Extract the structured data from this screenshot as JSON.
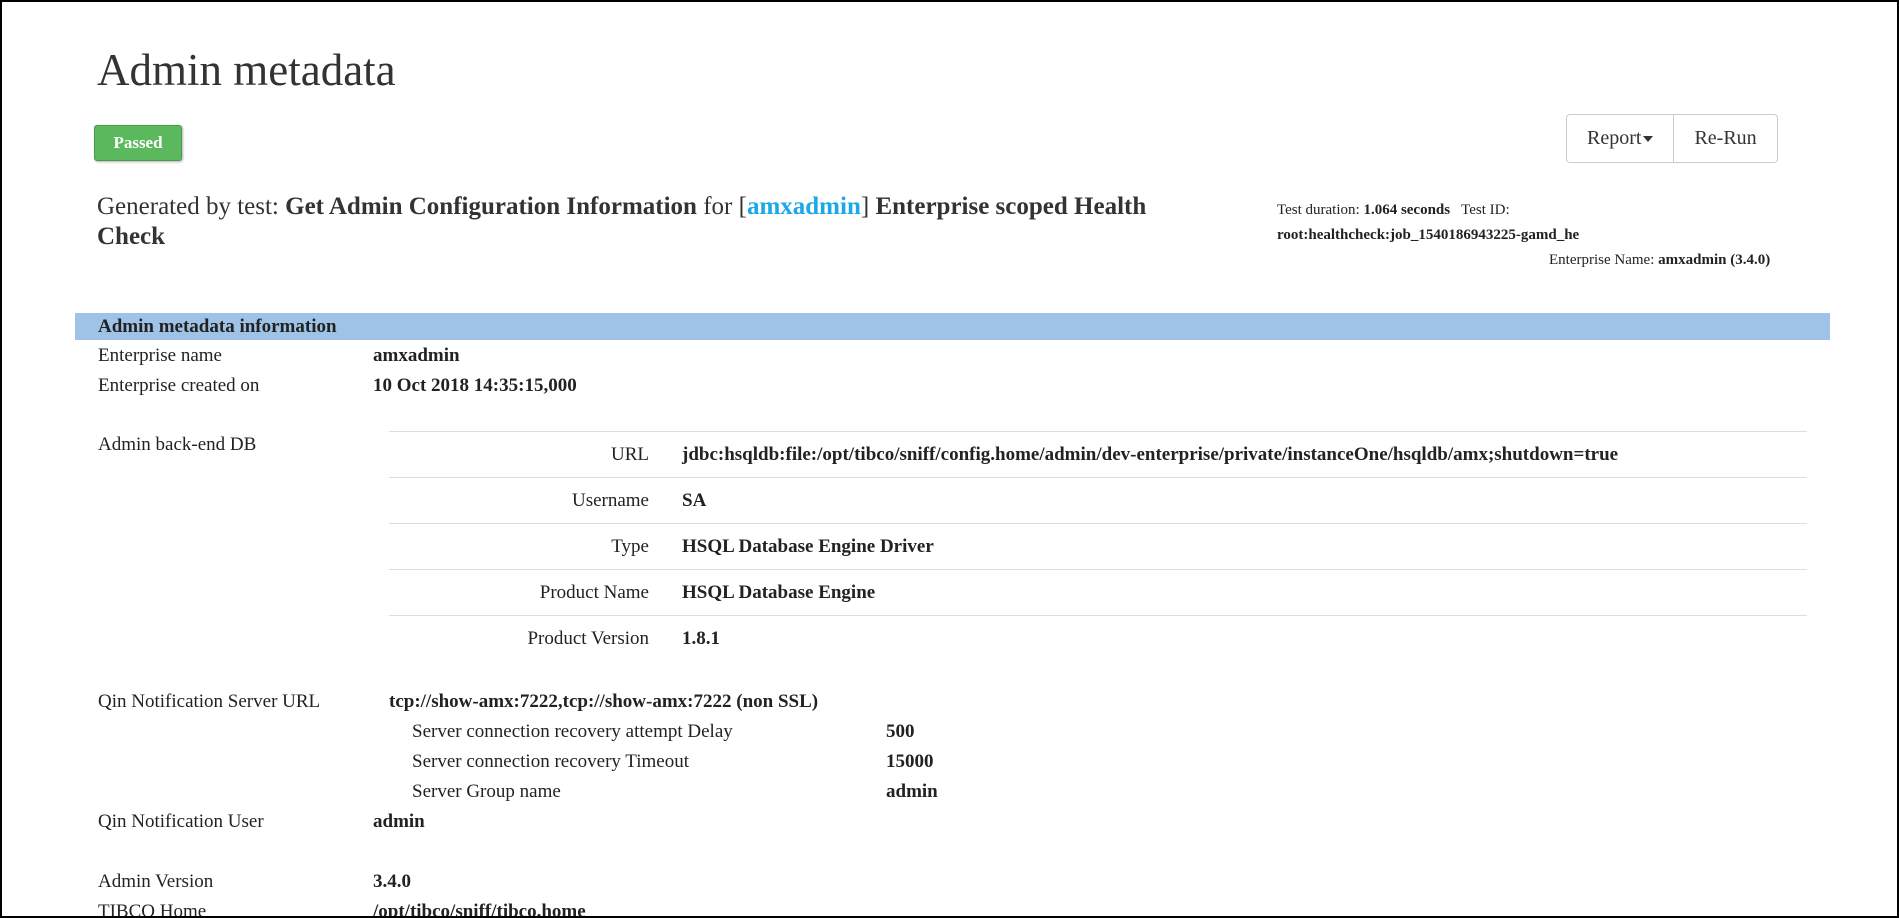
{
  "title": "Admin metadata",
  "status": "Passed",
  "buttons": {
    "report": "Report",
    "rerun": "Re-Run"
  },
  "generated": {
    "prefix": "Generated by test:",
    "test_name": "Get Admin Configuration Information",
    "for": "for",
    "bracket_open": "[",
    "enterprise": "amxadmin",
    "bracket_close": "]",
    "scope": "Enterprise scoped Health Check"
  },
  "info": {
    "duration_label": "Test duration:",
    "duration": "1.064 seconds",
    "testid_label": "Test ID:",
    "testid": "root:healthcheck:job_1540186943225-gamd_he",
    "ent_label": "Enterprise Name:",
    "ent": "amxadmin (3.4.0)"
  },
  "section": "Admin metadata information",
  "rows": {
    "ent_name": {
      "label": "Enterprise name",
      "value": "amxadmin"
    },
    "created": {
      "label": "Enterprise created on",
      "value": "10 Oct 2018 14:35:15,000"
    },
    "db_label": "Admin back-end DB",
    "db": [
      {
        "k": "URL",
        "v": "jdbc:hsqldb:file:/opt/tibco/sniff/config.home/admin/dev-enterprise/private/instanceOne/hsqldb/amx;shutdown=true"
      },
      {
        "k": "Username",
        "v": "SA"
      },
      {
        "k": "Type",
        "v": "HSQL Database Engine Driver"
      },
      {
        "k": "Product Name",
        "v": "HSQL Database Engine"
      },
      {
        "k": "Product Version",
        "v": "1.8.1"
      }
    ],
    "qin_url": {
      "label": "Qin Notification Server URL",
      "value": "tcp://show-amx:7222,tcp://show-amx:7222 (non SSL)"
    },
    "qin_sub": [
      {
        "k": "Server connection recovery attempt Delay",
        "v": "500"
      },
      {
        "k": "Server connection recovery Timeout",
        "v": "15000"
      },
      {
        "k": "Server Group name",
        "v": "admin"
      }
    ],
    "qin_user": {
      "label": "Qin Notification User",
      "value": "admin"
    },
    "admin_version": {
      "label": "Admin Version",
      "value": "3.4.0"
    },
    "tibco_home": {
      "label": "TIBCO Home",
      "value": "/opt/tibco/sniff/tibco.home"
    }
  }
}
